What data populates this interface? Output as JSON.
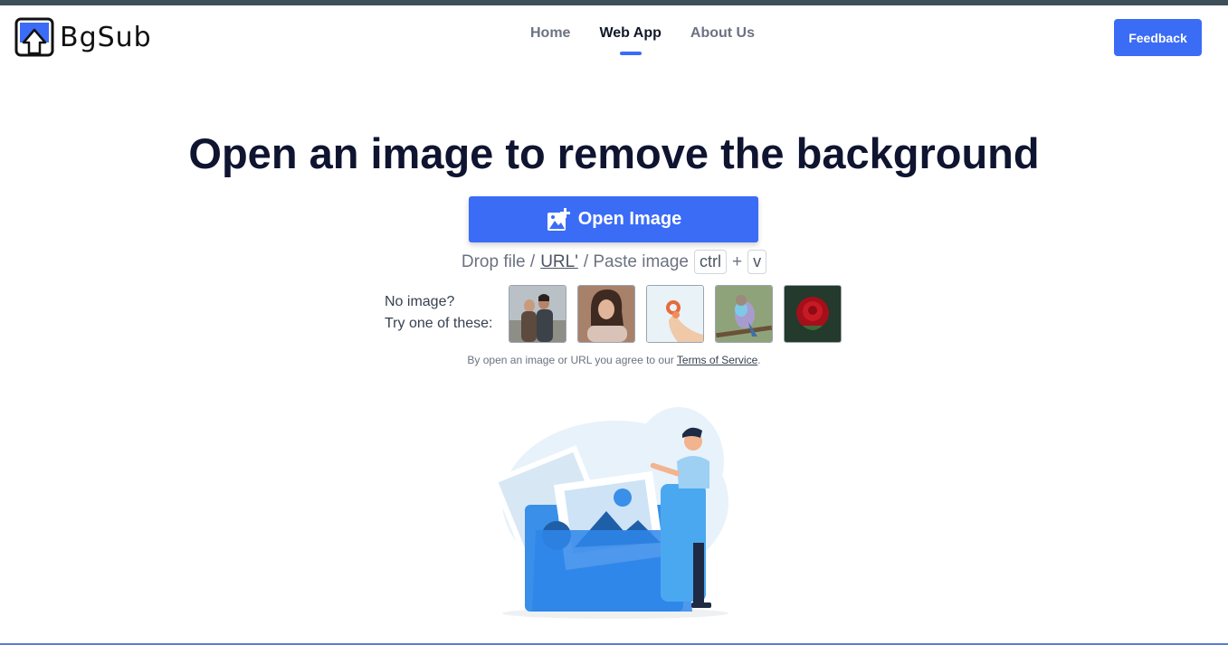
{
  "brand": {
    "name": "BgSub",
    "icon": "upload-photo-icon"
  },
  "nav": {
    "items": [
      {
        "label": "Home",
        "active": false
      },
      {
        "label": "Web App",
        "active": true
      },
      {
        "label": "About Us",
        "active": false
      }
    ]
  },
  "header": {
    "feedback_label": "Feedback"
  },
  "hero": {
    "title": "Open an image to remove the background",
    "open_label": "Open Image",
    "hint_prefix": "Drop file /",
    "hint_url": "URL'",
    "hint_mid": "/ Paste image",
    "key_ctrl": "ctrl",
    "plus": "+",
    "key_v": "v"
  },
  "samples": {
    "label_line1": "No image?",
    "label_line2": "Try one of these:",
    "items": [
      "couple-photo",
      "woman-photo",
      "hand-photo",
      "bird-photo",
      "rose-photo"
    ]
  },
  "terms": {
    "prefix": "By open an image or URL you agree to our",
    "link": "Terms of Service",
    "suffix": "."
  },
  "colors": {
    "accent": "#3b6cf6",
    "title": "#0f1530",
    "topbar": "#3f4f5a"
  }
}
